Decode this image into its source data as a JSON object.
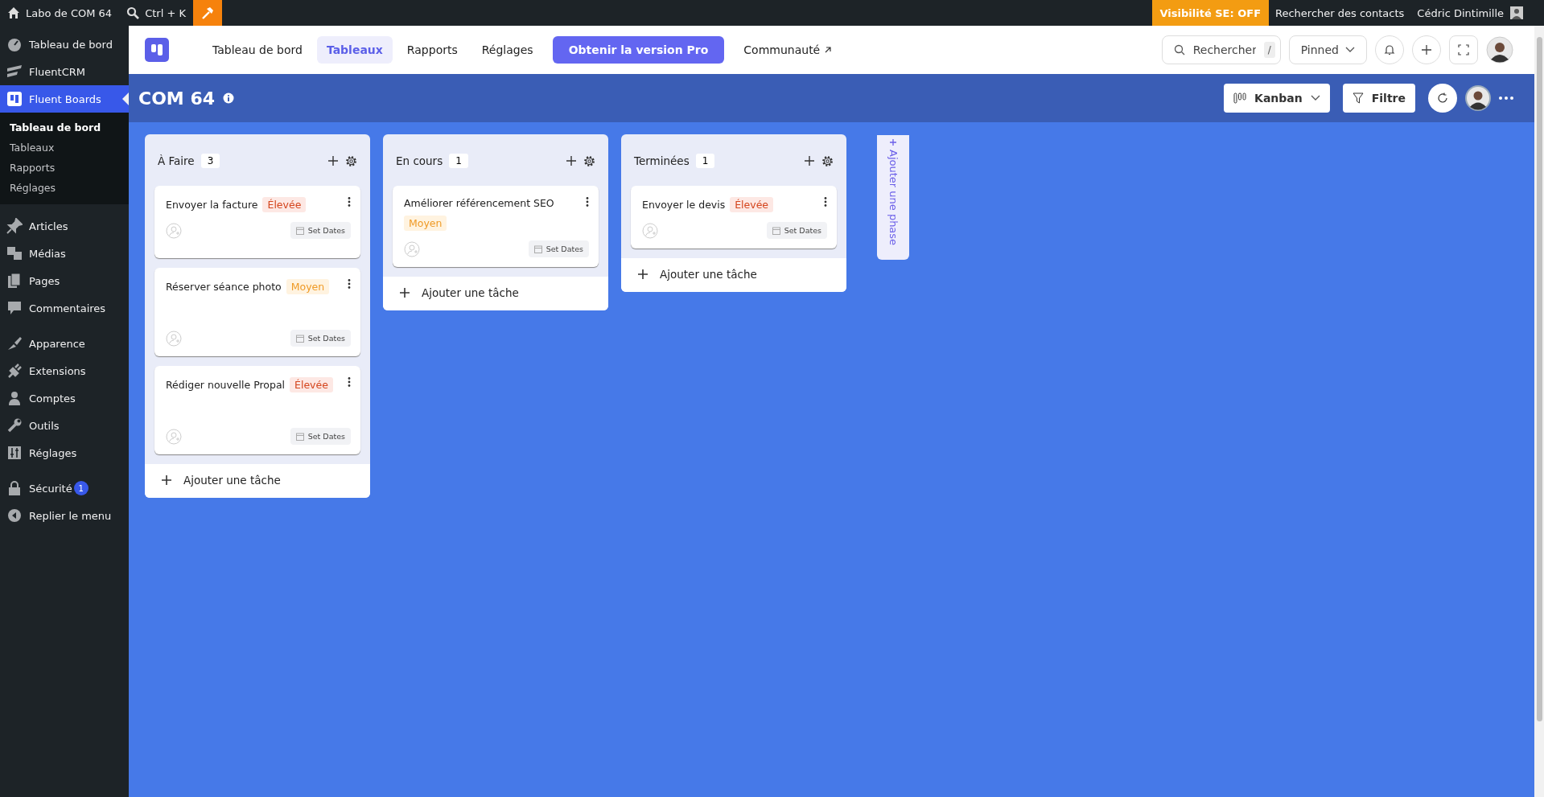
{
  "admin_bar": {
    "site": "Labo de COM 64",
    "search": "Ctrl + K",
    "visibility": "Visibilité SE: OFF",
    "contacts": "Rechercher des contacts",
    "user": "Cédric Dintimille"
  },
  "sidebar": {
    "items": [
      {
        "label": "Tableau de bord",
        "selected": false
      },
      {
        "label": "FluentCRM",
        "selected": false
      },
      {
        "label": "Fluent Boards",
        "selected": true,
        "children": [
          {
            "label": "Tableau de bord",
            "selected": true
          },
          {
            "label": "Tableaux",
            "selected": false
          },
          {
            "label": "Rapports",
            "selected": false
          },
          {
            "label": "Réglages",
            "selected": false
          }
        ]
      },
      {
        "label": "Articles",
        "selected": false
      },
      {
        "label": "Médias",
        "selected": false
      },
      {
        "label": "Pages",
        "selected": false
      },
      {
        "label": "Commentaires",
        "selected": false
      },
      {
        "label": "Apparence",
        "selected": false
      },
      {
        "label": "Extensions",
        "selected": false
      },
      {
        "label": "Comptes",
        "selected": false
      },
      {
        "label": "Outils",
        "selected": false
      },
      {
        "label": "Réglages",
        "selected": false
      },
      {
        "label": "Sécurité",
        "selected": false,
        "badge": "1"
      },
      {
        "label": "Replier le menu",
        "selected": false
      }
    ]
  },
  "nav": {
    "tabs": [
      {
        "label": "Tableau de bord",
        "kind": "tab",
        "selected": false
      },
      {
        "label": "Tableaux",
        "kind": "tab",
        "selected": true
      },
      {
        "label": "Rapports",
        "kind": "tab",
        "selected": false
      },
      {
        "label": "Réglages",
        "kind": "tab",
        "selected": false
      },
      {
        "label": "Obtenir la version Pro",
        "kind": "cta",
        "selected": false
      },
      {
        "label": "Communauté",
        "kind": "external",
        "selected": false
      }
    ],
    "search": {
      "placeholder": "Rechercher",
      "shortcut": "/"
    },
    "pinned": "Pinned"
  },
  "board": {
    "title": "COM 64",
    "view": "Kanban",
    "filter": "Filtre",
    "columns": [
      {
        "title": "À Faire",
        "count": "3",
        "tasks": [
          {
            "title": "Envoyer la facture",
            "priority": "Élevée",
            "kind": "high",
            "dates": "Set Dates"
          },
          {
            "title": "Réserver séance photo",
            "priority": "Moyen",
            "kind": "medium",
            "dates": "Set Dates"
          },
          {
            "title": "Rédiger nouvelle Propal",
            "priority": "Élevée",
            "kind": "high",
            "dates": "Set Dates"
          }
        ],
        "add": "Ajouter une tâche"
      },
      {
        "title": "En cours",
        "count": "1",
        "tasks": [
          {
            "title": "Améliorer référencement SEO",
            "priority": "Moyen",
            "kind": "medium",
            "dates": "Set Dates"
          }
        ],
        "add": "Ajouter une tâche"
      },
      {
        "title": "Terminées",
        "count": "1",
        "tasks": [
          {
            "title": "Envoyer le devis",
            "priority": "Élevée",
            "kind": "high",
            "dates": "Set Dates"
          }
        ],
        "add": "Ajouter une tâche"
      }
    ],
    "add_phase": "Ajouter une phase"
  }
}
